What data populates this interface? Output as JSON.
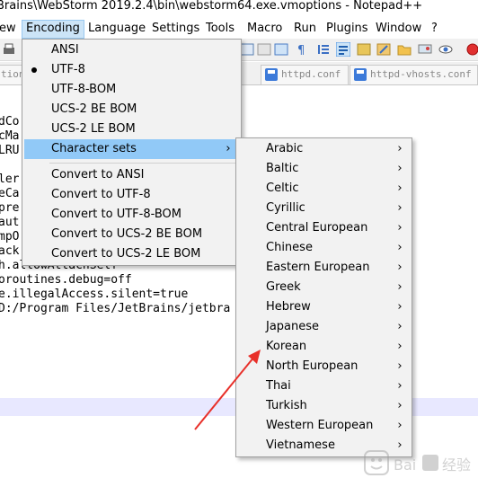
{
  "window": {
    "title": "Brains\\WebStorm 2019.2.4\\bin\\webstorm64.exe.vmoptions - Notepad++"
  },
  "menubar": {
    "items": [
      "ew",
      "Encoding",
      "Language",
      "Settings",
      "Tools",
      "Macro",
      "Run",
      "Plugins",
      "Window",
      "?"
    ]
  },
  "tabs": [
    {
      "label": "tion"
    },
    {
      "label": "httpd.conf"
    },
    {
      "label": "httpd-vhosts.conf"
    }
  ],
  "editor": {
    "lines": [
      "dCo",
      "cMa",
      "LRU",
      "ler",
      "eCa",
      "pre",
      "aut",
      "mpO",
      "ack",
      "h.allowAttachSelf",
      "oroutines.debug=off",
      "e.illegalAccess.silent=true",
      "D:/Program Files/JetBrains/jetbra"
    ]
  },
  "encoding_menu": {
    "items": [
      {
        "label": "ANSI",
        "checked": false
      },
      {
        "label": "UTF-8",
        "checked": true
      },
      {
        "label": "UTF-8-BOM",
        "checked": false
      },
      {
        "label": "UCS-2 BE BOM",
        "checked": false
      },
      {
        "label": "UCS-2 LE BOM",
        "checked": false
      },
      {
        "label": "Character sets",
        "submenu": true,
        "highlighted": true
      },
      {
        "label": "Convert to ANSI"
      },
      {
        "label": "Convert to UTF-8"
      },
      {
        "label": "Convert to UTF-8-BOM"
      },
      {
        "label": "Convert to UCS-2 BE BOM"
      },
      {
        "label": "Convert to UCS-2 LE BOM"
      }
    ]
  },
  "charsets_menu": {
    "items": [
      "Arabic",
      "Baltic",
      "Celtic",
      "Cyrillic",
      "Central European",
      "Chinese",
      "Eastern European",
      "Greek",
      "Hebrew",
      "Japanese",
      "Korean",
      "North European",
      "Thai",
      "Turkish",
      "Western European",
      "Vietnamese"
    ],
    "chevron": "›"
  },
  "colors": {
    "menu_highlight": "#91c9f7",
    "arrow": "#e8302a",
    "current_line": "#e8e8ff"
  },
  "watermark": {
    "text": "Baidu 经验"
  }
}
